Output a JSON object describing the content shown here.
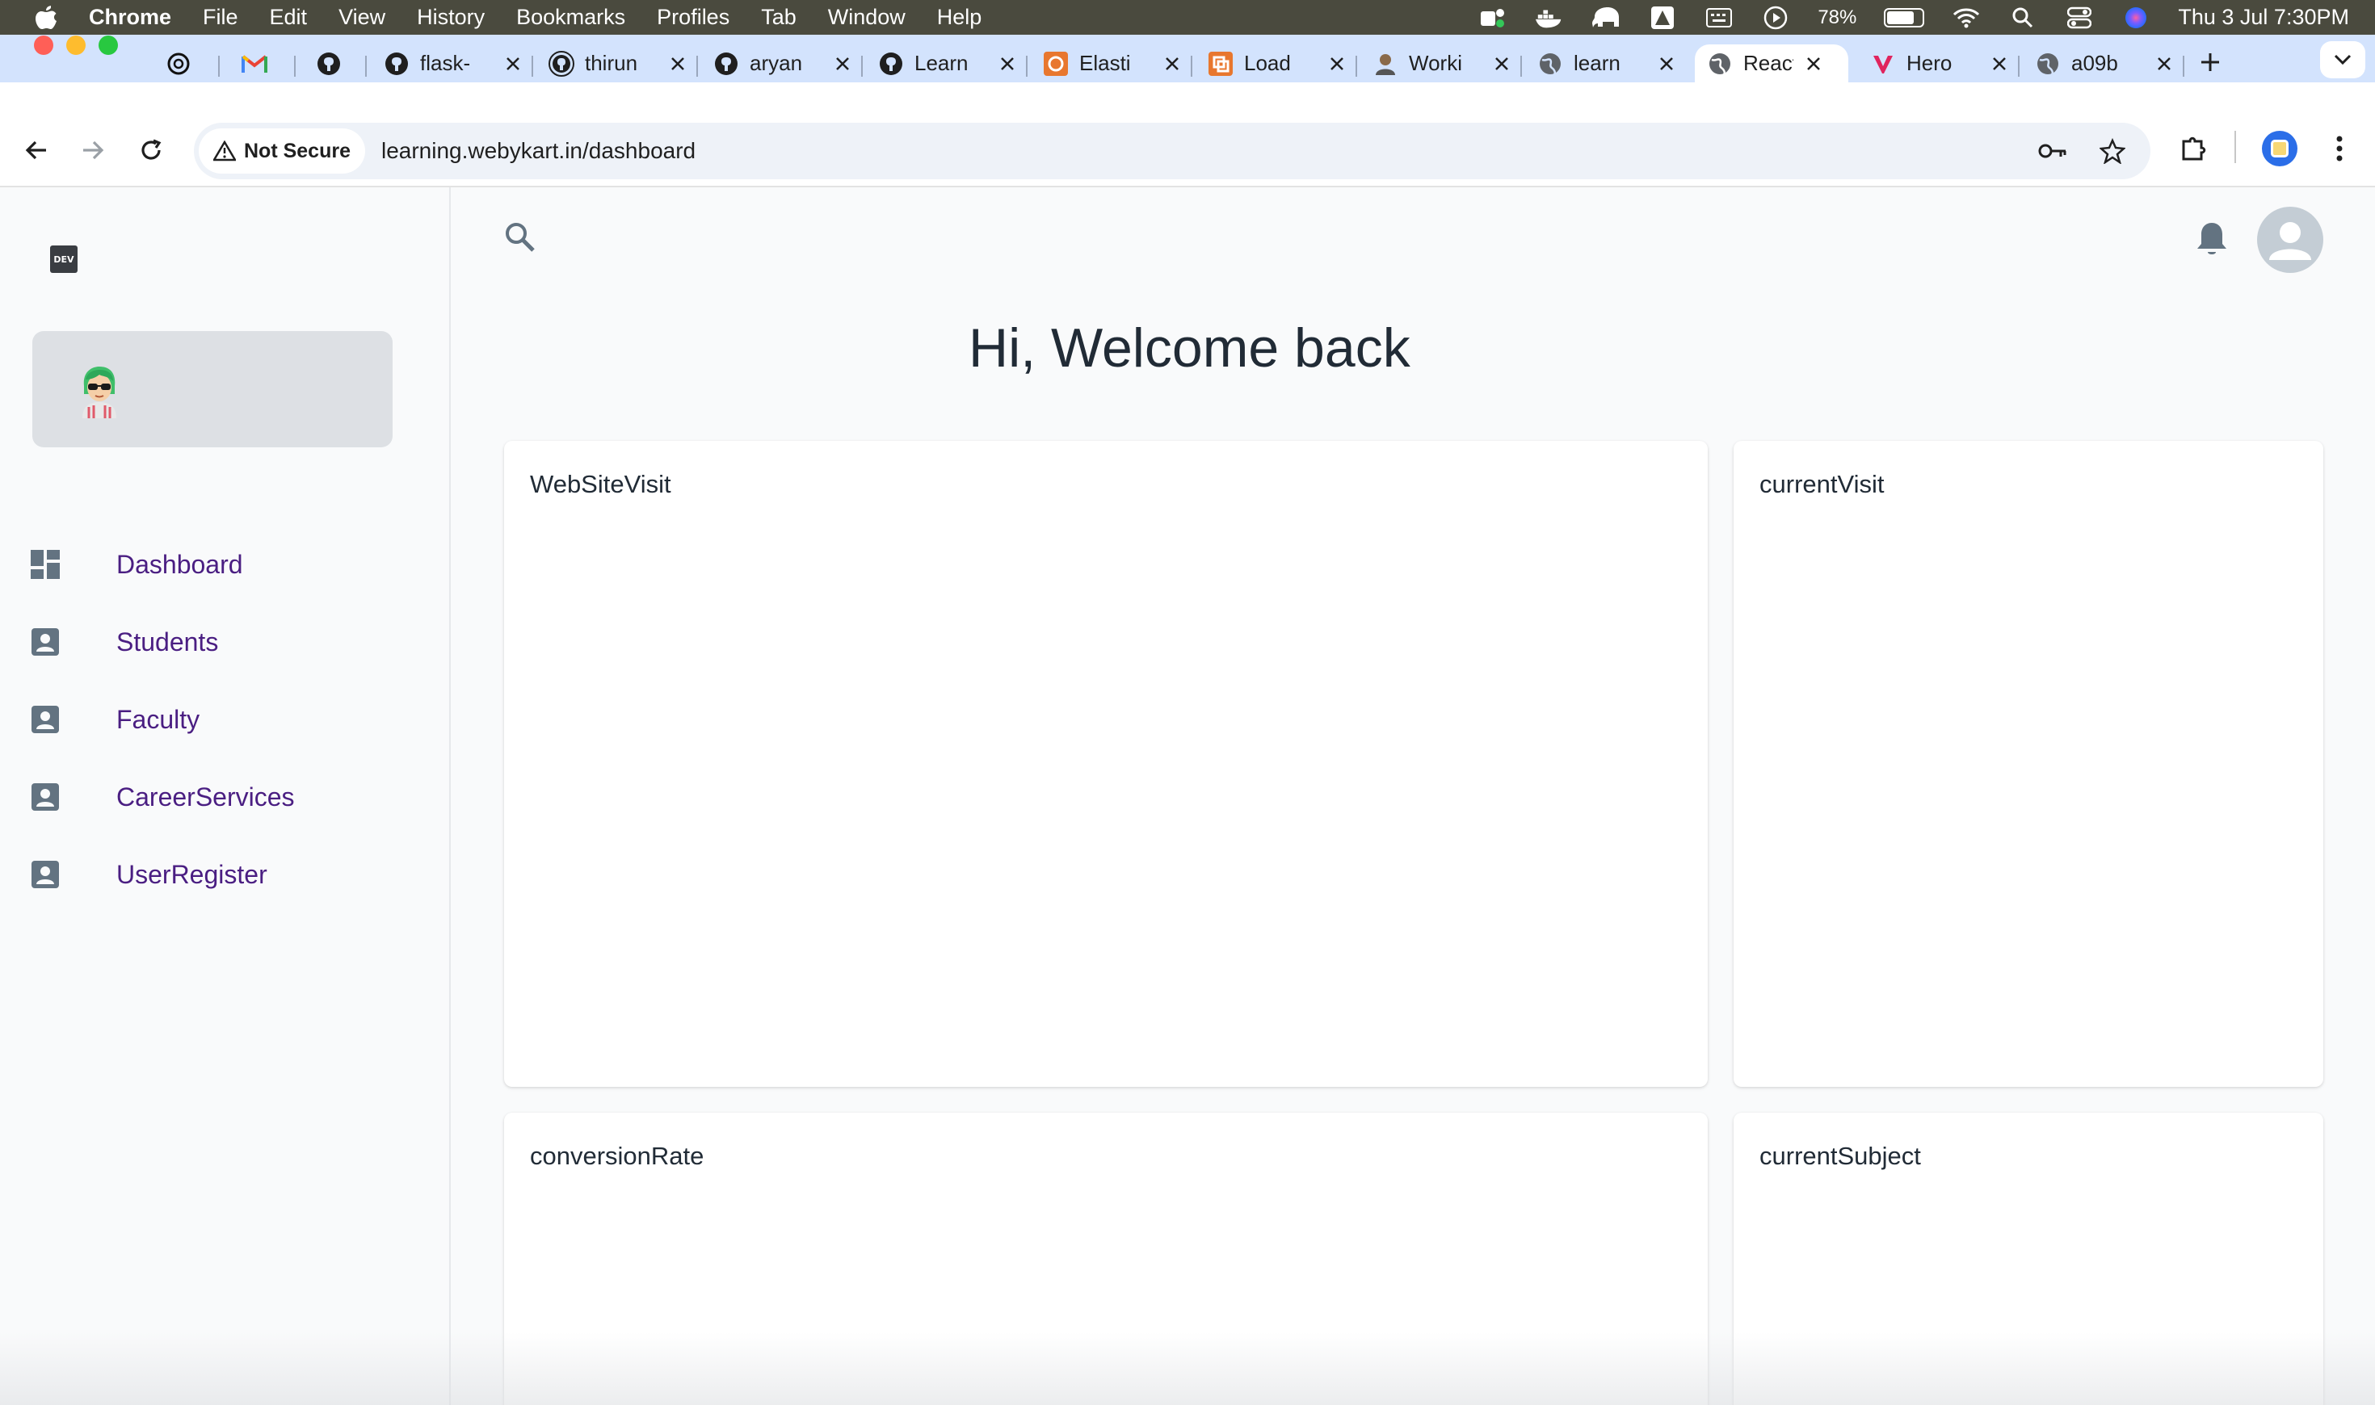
{
  "menubar": {
    "app_name": "Chrome",
    "menus": [
      "File",
      "Edit",
      "View",
      "History",
      "Bookmarks",
      "Profiles",
      "Tab",
      "Window",
      "Help"
    ],
    "battery": "78%",
    "battery_level": 0.78,
    "datetime": "Thu 3 Jul  7:30PM"
  },
  "tabs": [
    {
      "label": "",
      "favicon": "openai-icon"
    },
    {
      "label": "",
      "favicon": "gmail-icon"
    },
    {
      "label": "",
      "favicon": "github-icon"
    },
    {
      "label": "flask-",
      "favicon": "github-icon"
    },
    {
      "label": "thirun",
      "favicon": "github-icon"
    },
    {
      "label": "aryan",
      "favicon": "github-icon"
    },
    {
      "label": "Learn",
      "favicon": "github-icon"
    },
    {
      "label": "Elasti",
      "favicon": "elastic-icon"
    },
    {
      "label": "Load",
      "favicon": "load-icon"
    },
    {
      "label": "Worki",
      "favicon": "person-icon"
    },
    {
      "label": "learn",
      "favicon": "globe-icon"
    },
    {
      "label": "React",
      "favicon": "globe-icon",
      "active": true
    },
    {
      "label": "Hero",
      "favicon": "vercel-icon"
    },
    {
      "label": "a09b",
      "favicon": "globe-icon"
    }
  ],
  "toolbar": {
    "security_label": "Not Secure",
    "url": "learning.webykart.in/dashboard"
  },
  "sidebar": {
    "logo_text": "DEV",
    "items": [
      {
        "label": "Dashboard",
        "icon": "dashboard-icon"
      },
      {
        "label": "Students",
        "icon": "contact-icon"
      },
      {
        "label": "Faculty",
        "icon": "contact-icon"
      },
      {
        "label": "CareerServices",
        "icon": "contact-icon"
      },
      {
        "label": "UserRegister",
        "icon": "contact-icon"
      }
    ]
  },
  "main": {
    "greeting": "Hi, Welcome back",
    "cards": [
      {
        "title": "WebSiteVisit"
      },
      {
        "title": "currentVisit"
      },
      {
        "title": "conversionRate"
      },
      {
        "title": "currentSubject"
      }
    ]
  },
  "colors": {
    "nav_text": "#4a1e82",
    "tab_strip": "#d3e3fd",
    "menubar": "#4a4a3e"
  }
}
